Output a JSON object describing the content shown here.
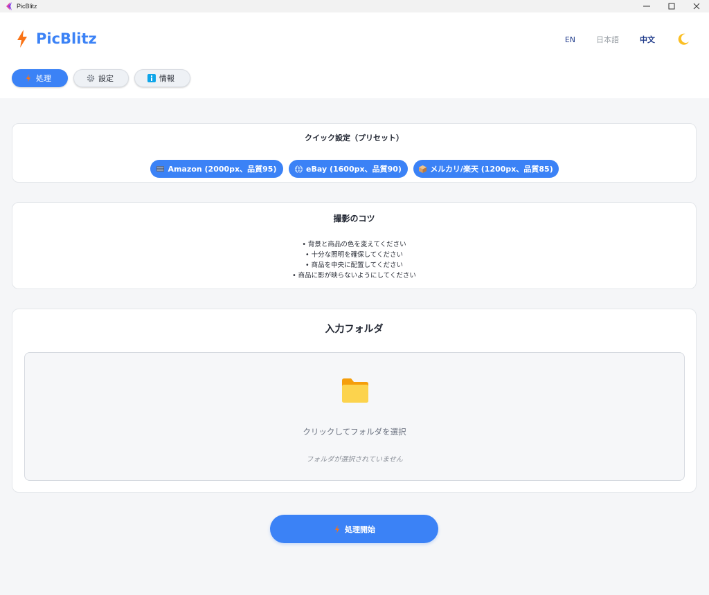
{
  "window": {
    "title": "PicBlitz",
    "controls": [
      "minimize-icon",
      "maximize-icon",
      "close-icon"
    ]
  },
  "header": {
    "brand_name": "PicBlitz",
    "brand_icon": "lightning-icon",
    "languages": [
      "EN",
      "日本語",
      "中文"
    ],
    "theme_icon": "moon-icon"
  },
  "tabs": [
    {
      "label": "処理",
      "icon": "lightning-icon",
      "active": true
    },
    {
      "label": "設定",
      "icon": "gear-icon",
      "active": false
    },
    {
      "label": "情報",
      "icon": "info-icon",
      "active": false
    }
  ],
  "quick_settings": {
    "title": "クイック設定（プリセット）",
    "presets": [
      {
        "label": "Amazon (2000px、品質95)",
        "icon": "box-icon"
      },
      {
        "label": "eBay (1600px、品質90)",
        "icon": "globe-icon"
      },
      {
        "label": "メルカリ/楽天 (1200px、品質85)",
        "icon": "package-icon"
      }
    ]
  },
  "tips": {
    "title": "撮影のコツ",
    "items": [
      "• 背景と商品の色を変えてください",
      "• 十分な照明を確保してください",
      "• 商品を中央に配置してください",
      "• 商品に影が映らないようにしてください"
    ]
  },
  "input_folder": {
    "title": "入力フォルダ",
    "select_label": "クリックしてフォルダを選択",
    "status": "フォルダが選択されていません",
    "icon": "folder-icon"
  },
  "start_button": {
    "label": "処理開始",
    "icon": "lightning-icon"
  },
  "colors": {
    "accent": "#3b82f6",
    "background": "#f5f6f8",
    "bolt": "#f97316",
    "folder": "#fbbf24"
  }
}
